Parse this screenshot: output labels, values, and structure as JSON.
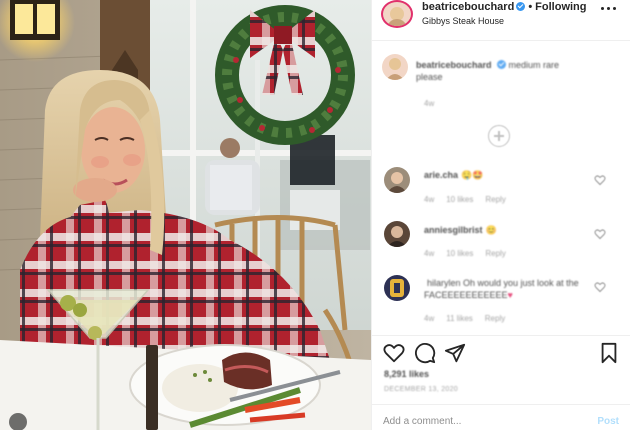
{
  "post": {
    "username": "beatricebouchard",
    "follow_separator": "•",
    "follow_status": "Following",
    "location": "Gibbys Steak House"
  },
  "caption": {
    "username": "beatricebouchard",
    "text": "medium rare please",
    "time": "4w"
  },
  "comments": [
    {
      "username": "arie.cha",
      "text": "🤤🤩",
      "time": "4w",
      "likes": "10 likes",
      "reply": "Reply"
    },
    {
      "username": "anniesgilbrist",
      "text": "😊",
      "time": "4w",
      "likes": "10 likes",
      "reply": "Reply"
    },
    {
      "username": "",
      "text": "hilarylen Oh would you just look at the FACEEEEEEEEEEE",
      "time": "4w",
      "likes": "11 likes",
      "reply": "Reply"
    }
  ],
  "footer": {
    "likes": "8,291 likes",
    "date": "DECEMBER 13, 2020"
  },
  "add_comment": {
    "placeholder": "Add a comment...",
    "post_label": "Post"
  },
  "icons": {
    "heart": "heart-icon",
    "comment": "comment-icon",
    "share": "paper-plane-icon",
    "save": "bookmark-icon",
    "more": "more-options-icon",
    "verified": "verified-badge-icon",
    "load_more": "plus-circle-icon"
  },
  "colors": {
    "story_ring": "#e1306c",
    "verified": "#3897f0",
    "post_button_disabled": "#b2dffc",
    "secondary_text": "#8e8e8e",
    "divider": "#efefef"
  }
}
